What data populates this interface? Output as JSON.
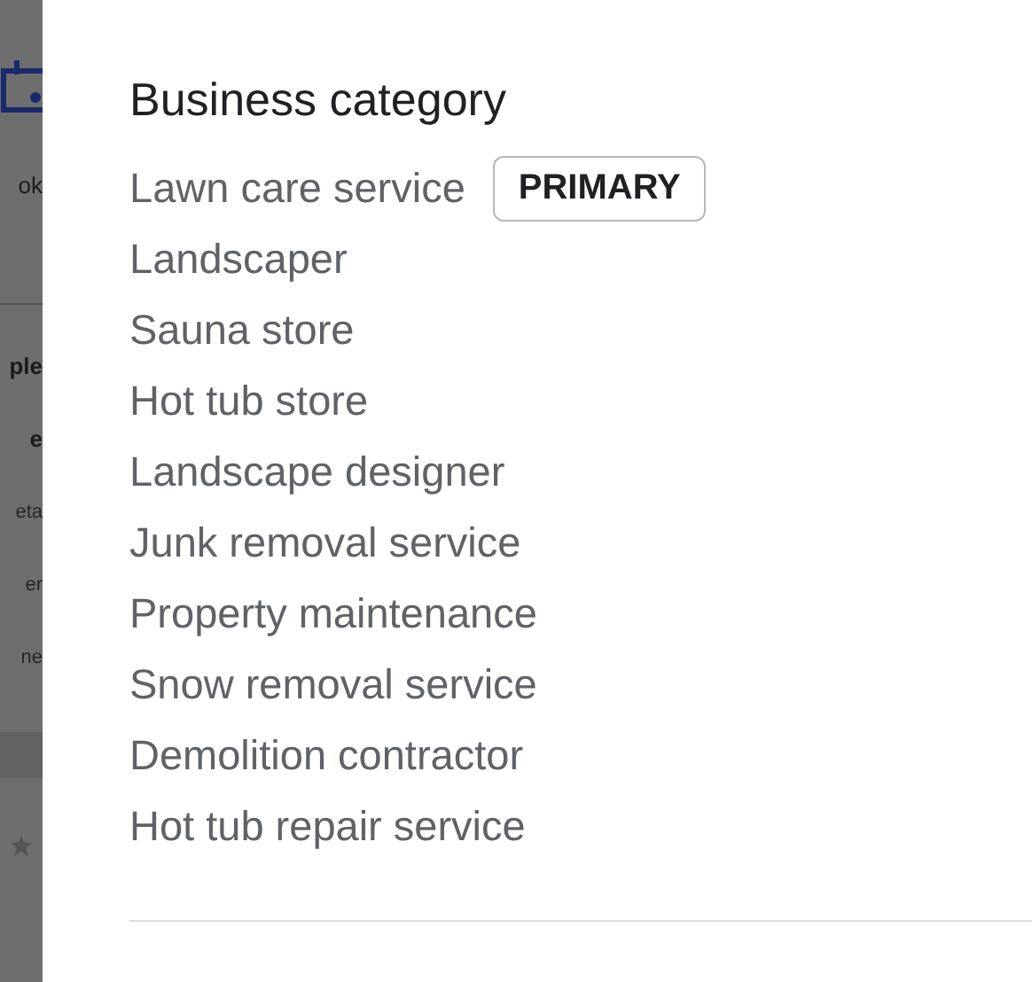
{
  "background": {
    "fragments": [
      {
        "text": "ok",
        "kind": "label"
      },
      {
        "text": "ple",
        "kind": "heading"
      },
      {
        "text": "e",
        "kind": "heading"
      },
      {
        "text": "eta",
        "kind": "body"
      },
      {
        "text": "er",
        "kind": "body"
      },
      {
        "text": "ne",
        "kind": "body"
      }
    ]
  },
  "panel": {
    "title": "Business category",
    "categories": [
      {
        "name": "Lawn care service",
        "badge": "PRIMARY"
      },
      {
        "name": "Landscaper"
      },
      {
        "name": "Sauna store"
      },
      {
        "name": "Hot tub store"
      },
      {
        "name": "Landscape designer"
      },
      {
        "name": "Junk removal service"
      },
      {
        "name": "Property maintenance"
      },
      {
        "name": "Snow removal service"
      },
      {
        "name": "Demolition contractor"
      },
      {
        "name": "Hot tub repair service"
      }
    ]
  }
}
